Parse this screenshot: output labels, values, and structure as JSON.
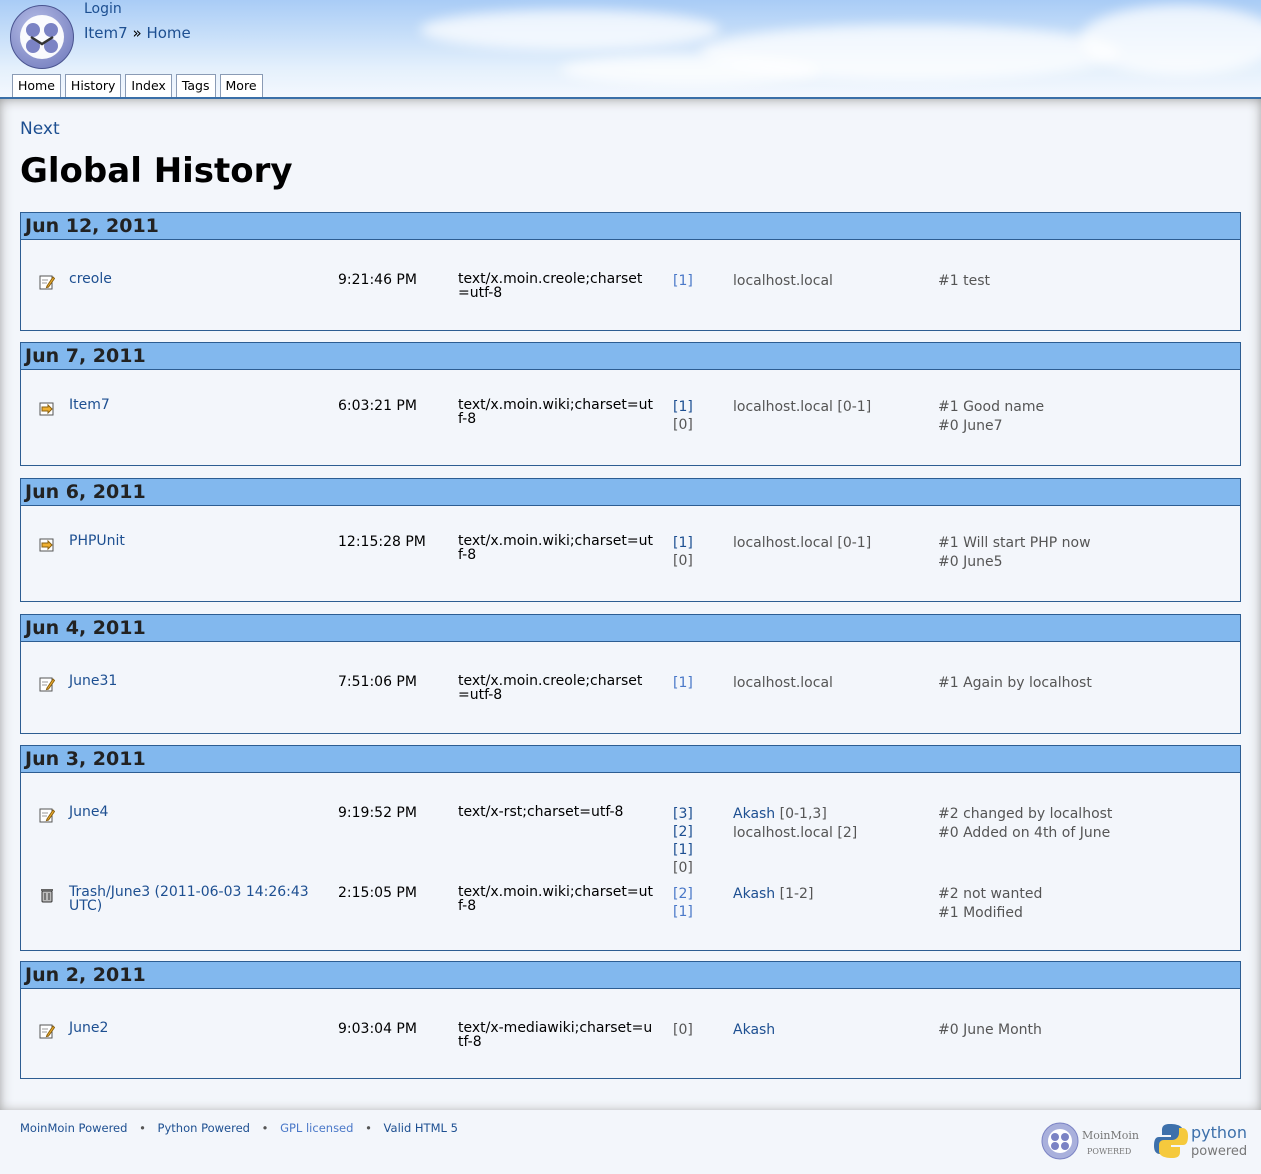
{
  "header": {
    "login": "Login",
    "breadcrumb_item": "Item7",
    "breadcrumb_sep": "»",
    "breadcrumb_home": "Home",
    "tabs": [
      "Home",
      "History",
      "Index",
      "Tags",
      "More"
    ]
  },
  "main": {
    "next_link": "Next",
    "title": "Global History",
    "days": [
      {
        "date": "Jun 12, 2011",
        "entries": [
          {
            "icon": "edit-icon",
            "name": "creole",
            "time": "9:21:46 PM",
            "content_type": "text/x.moin.creole;charset=utf-8",
            "revs": [
              "[1]"
            ],
            "editors": [
              "localhost.local"
            ],
            "comments": [
              "#1 test"
            ]
          }
        ]
      },
      {
        "date": "Jun 7, 2011",
        "entries": [
          {
            "icon": "rename-icon",
            "name": "Item7",
            "time": "6:03:21 PM",
            "content_type": "text/x.moin.wiki;charset=utf-8",
            "revs": [
              "[1]",
              "[0]"
            ],
            "editors": [
              "localhost.local [0-1]"
            ],
            "comments": [
              "#1 Good name",
              "#0 June7"
            ]
          }
        ]
      },
      {
        "date": "Jun 6, 2011",
        "entries": [
          {
            "icon": "rename-icon",
            "name": "PHPUnit",
            "time": "12:15:28 PM",
            "content_type": "text/x.moin.wiki;charset=utf-8",
            "revs": [
              "[1]",
              "[0]"
            ],
            "editors": [
              "localhost.local [0-1]"
            ],
            "comments": [
              "#1 Will start PHP now",
              "#0 June5"
            ]
          }
        ]
      },
      {
        "date": "Jun 4, 2011",
        "entries": [
          {
            "icon": "edit-icon",
            "name": "June31",
            "time": "7:51:06 PM",
            "content_type": "text/x.moin.creole;charset=utf-8",
            "revs": [
              "[1]"
            ],
            "editors": [
              "localhost.local"
            ],
            "comments": [
              "#1 Again by localhost"
            ]
          }
        ]
      },
      {
        "date": "Jun 3, 2011",
        "entries": [
          {
            "icon": "edit-icon",
            "name": "June4",
            "time": "9:19:52 PM",
            "content_type": "text/x-rst;charset=utf-8",
            "revs": [
              "[3]",
              "[2]",
              "[1]",
              "[0]"
            ],
            "editor_links": [
              "Akash",
              ""
            ],
            "editors": [
              "[0-1,3]",
              "localhost.local [2]"
            ],
            "comments": [
              "#2 changed by localhost",
              "#0 Added on 4th of June"
            ]
          },
          {
            "icon": "trash-icon",
            "name": "Trash/June3 (2011-06-03 14:26:43 UTC)",
            "time": "2:15:05 PM",
            "content_type": "text/x.moin.wiki;charset=utf-8",
            "revs": [
              "[2]",
              "[1]"
            ],
            "editor_links": [
              "Akash"
            ],
            "editors": [
              "[1-2]"
            ],
            "comments": [
              "#2 not wanted",
              "#1 Modified"
            ]
          }
        ]
      },
      {
        "date": "Jun 2, 2011",
        "entries": [
          {
            "icon": "edit-icon",
            "name": "June2",
            "time": "9:03:04 PM",
            "content_type": "text/x-mediawiki;charset=utf-8",
            "revs": [
              "[0]"
            ],
            "editor_links": [
              "Akash"
            ],
            "editors": [
              ""
            ],
            "comments": [
              "#0 June Month"
            ]
          }
        ]
      }
    ]
  },
  "footer": {
    "links": [
      "MoinMoin Powered",
      "Python Powered",
      "GPL licensed",
      "Valid HTML 5"
    ],
    "separator": "•",
    "moin_badge_top": "MoinMoin",
    "moin_badge_bottom": "POWERED",
    "python_badge_top": "python",
    "python_badge_bottom": "powered"
  },
  "colors": {
    "link": "#1d4f91",
    "day_header": "#82b8ee",
    "border": "#2d5d92"
  }
}
